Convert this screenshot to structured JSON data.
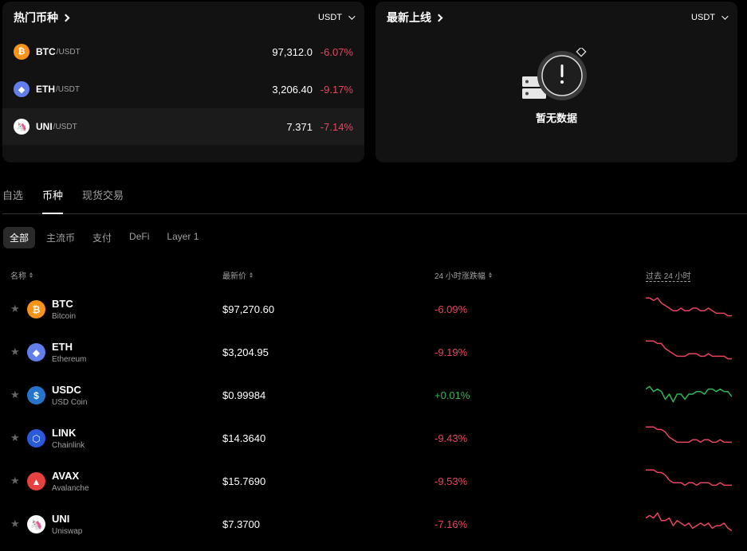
{
  "hot": {
    "title": "热门币种",
    "quote_select": "USDT",
    "rows": [
      {
        "symbol": "BTC",
        "quote": "/USDT",
        "price": "97,312.0",
        "change": "-6.07%",
        "icon": "bitcoin-icon",
        "color": "#f7931a",
        "glyph": "₿"
      },
      {
        "symbol": "ETH",
        "quote": "/USDT",
        "price": "3,206.40",
        "change": "-9.17%",
        "icon": "ethereum-icon",
        "color": "#627eea",
        "glyph": "◆"
      },
      {
        "symbol": "UNI",
        "quote": "/USDT",
        "price": "7.371",
        "change": "-7.14%",
        "icon": "uniswap-icon",
        "color": "#ffffff",
        "glyph": "🦄"
      }
    ]
  },
  "new_listings": {
    "title": "最新上线",
    "quote_select": "USDT",
    "empty_text": "暂无数据"
  },
  "tabs": [
    {
      "label": "自选",
      "active": false
    },
    {
      "label": "币种",
      "active": true
    },
    {
      "label": "现货交易",
      "active": false
    }
  ],
  "chips": [
    {
      "label": "全部",
      "active": true
    },
    {
      "label": "主流币",
      "active": false
    },
    {
      "label": "支付",
      "active": false
    },
    {
      "label": "DeFi",
      "active": false
    },
    {
      "label": "Layer 1",
      "active": false
    }
  ],
  "table": {
    "headers": {
      "name": "名称",
      "price": "最新价",
      "change": "24 小时涨跌幅",
      "spark": "过去 24 小时"
    },
    "rows": [
      {
        "symbol": "BTC",
        "name": "Bitcoin",
        "price": "$97,270.60",
        "change": "-6.09%",
        "trend": "down",
        "icon": "bitcoin-icon",
        "color": "#f7931a",
        "glyph": "₿",
        "spark": [
          9,
          9,
          8,
          9,
          7,
          6,
          5,
          4,
          4,
          5,
          4,
          4,
          5,
          5,
          4,
          4,
          5,
          4,
          3,
          3,
          3,
          2,
          2
        ]
      },
      {
        "symbol": "ETH",
        "name": "Ethereum",
        "price": "$3,204.95",
        "change": "-9.19%",
        "trend": "down",
        "icon": "ethereum-icon",
        "color": "#627eea",
        "glyph": "◆",
        "spark": [
          9,
          9,
          9,
          8,
          8,
          6,
          5,
          4,
          3,
          3,
          3,
          4,
          4,
          4,
          3,
          3,
          4,
          3,
          3,
          3,
          3,
          2,
          2
        ]
      },
      {
        "symbol": "USDC",
        "name": "USD Coin",
        "price": "$0.99984",
        "change": "+0.01%",
        "trend": "up",
        "icon": "usdc-icon",
        "color": "#2775ca",
        "glyph": "$",
        "spark": [
          7,
          8,
          6,
          7,
          6,
          3,
          5,
          2,
          5,
          5,
          3,
          5,
          5,
          6,
          6,
          5,
          7,
          7,
          6,
          7,
          6,
          6,
          4
        ]
      },
      {
        "symbol": "LINK",
        "name": "Chainlink",
        "price": "$14.3640",
        "change": "-9.43%",
        "trend": "down",
        "icon": "chainlink-icon",
        "color": "#2a5ada",
        "glyph": "⬡",
        "spark": [
          9,
          9,
          9,
          8,
          8,
          7,
          5,
          4,
          3,
          3,
          3,
          3,
          4,
          4,
          3,
          4,
          4,
          3,
          3,
          4,
          3,
          3,
          3
        ]
      },
      {
        "symbol": "AVAX",
        "name": "Avalanche",
        "price": "$15.7690",
        "change": "-9.53%",
        "trend": "down",
        "icon": "avalanche-icon",
        "color": "#e84142",
        "glyph": "▲",
        "spark": [
          9,
          9,
          9,
          8,
          8,
          7,
          5,
          4,
          4,
          4,
          3,
          4,
          4,
          3,
          4,
          4,
          4,
          3,
          3,
          4,
          3,
          3,
          3
        ]
      },
      {
        "symbol": "UNI",
        "name": "Uniswap",
        "price": "$7.3700",
        "change": "-7.16%",
        "trend": "down",
        "icon": "uniswap-icon",
        "color": "#ffffff",
        "glyph": "🦄",
        "spark": [
          7,
          8,
          7,
          9,
          6,
          6,
          7,
          4,
          6,
          5,
          4,
          5,
          3,
          4,
          5,
          4,
          5,
          3,
          4,
          4,
          5,
          3,
          2
        ]
      }
    ]
  },
  "colors": {
    "negative": "#e8455f",
    "positive": "#2fb55b",
    "card": "#121212"
  }
}
